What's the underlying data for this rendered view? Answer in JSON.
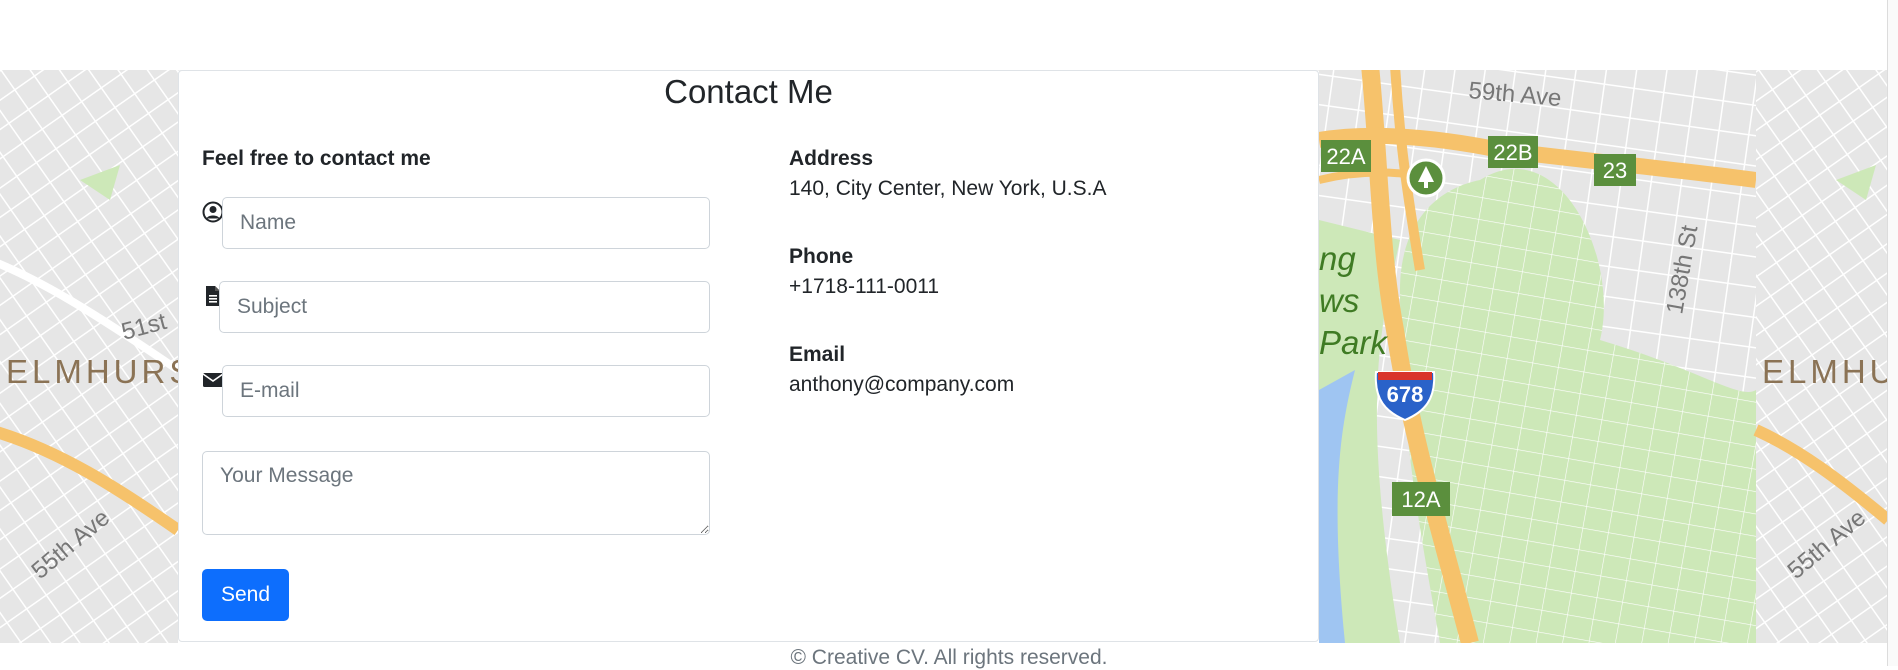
{
  "page": {
    "title": "Contact Me",
    "footer": "© Creative CV. All rights reserved."
  },
  "form": {
    "heading": "Feel free to contact me",
    "name_placeholder": "Name",
    "subject_placeholder": "Subject",
    "email_placeholder": "E-mail",
    "message_placeholder": "Your Message",
    "send_label": "Send",
    "icons": [
      "user-circle-icon",
      "file-text-icon",
      "envelope-icon"
    ]
  },
  "info": {
    "address_label": "Address",
    "address_value": "140, City Center, New York, U.S.A",
    "phone_label": "Phone",
    "phone_value": "+1718-111-0011",
    "email_label": "Email",
    "email_value": "anthony@company.com"
  },
  "map": {
    "labels": {
      "elmhurst": "ELMHURS",
      "elmhurst_right": "ELMHU",
      "st51": "51st",
      "ave55": "55th Ave",
      "ave59": "59th Ave",
      "st138": "138th St",
      "park1": "ng",
      "park2": "ws",
      "park3": "Park",
      "exit22a": "22A",
      "exit22b": "22B",
      "exit23": "23",
      "exit12a": "12A",
      "interstate": "678"
    }
  },
  "colors": {
    "accent": "#0d6efd",
    "map_park": "#cde8b8",
    "map_highway": "#f6c26b",
    "map_water": "#9fc5f2",
    "exit_sign": "#5b8f3d"
  }
}
